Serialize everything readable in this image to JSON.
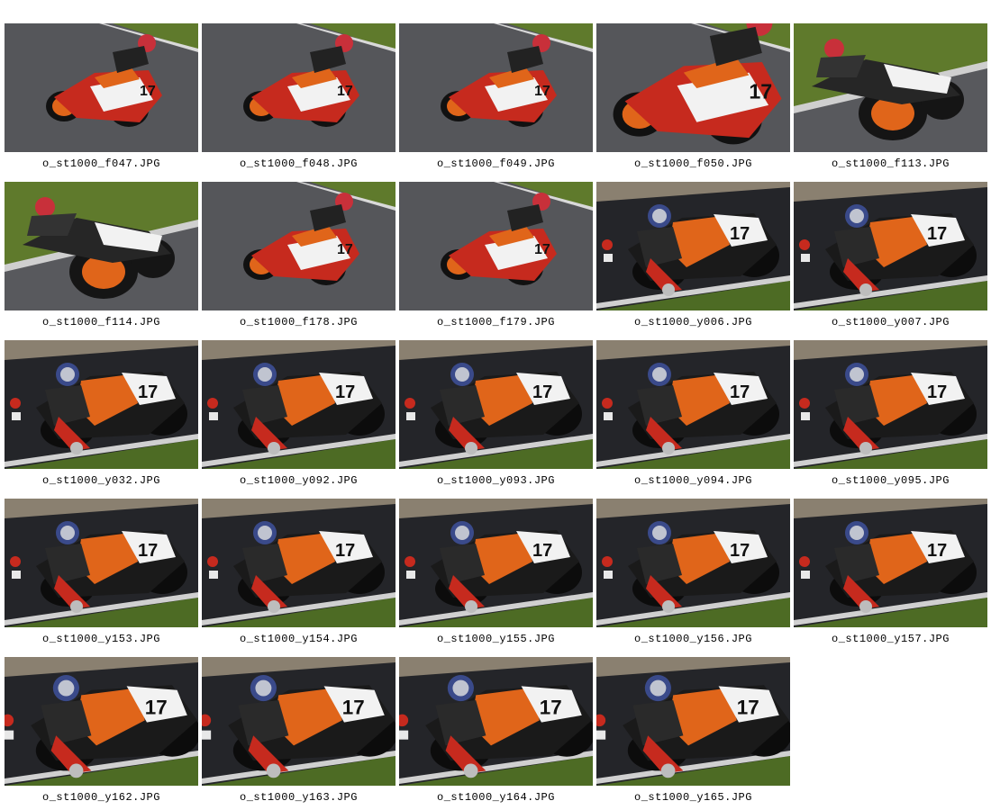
{
  "gallery": {
    "items": [
      {
        "filename": "o_st1000_f047.JPG",
        "scene": "f-far"
      },
      {
        "filename": "o_st1000_f048.JPG",
        "scene": "f-far"
      },
      {
        "filename": "o_st1000_f049.JPG",
        "scene": "f-far"
      },
      {
        "filename": "o_st1000_f050.JPG",
        "scene": "f-close"
      },
      {
        "filename": "o_st1000_f113.JPG",
        "scene": "f-rear"
      },
      {
        "filename": "o_st1000_f114.JPG",
        "scene": "f-rear"
      },
      {
        "filename": "o_st1000_f178.JPG",
        "scene": "f-far"
      },
      {
        "filename": "o_st1000_f179.JPG",
        "scene": "f-far"
      },
      {
        "filename": "o_st1000_y006.JPG",
        "scene": "y"
      },
      {
        "filename": "o_st1000_y007.JPG",
        "scene": "y"
      },
      {
        "filename": "o_st1000_y032.JPG",
        "scene": "y"
      },
      {
        "filename": "o_st1000_y092.JPG",
        "scene": "y"
      },
      {
        "filename": "o_st1000_y093.JPG",
        "scene": "y"
      },
      {
        "filename": "o_st1000_y094.JPG",
        "scene": "y"
      },
      {
        "filename": "o_st1000_y095.JPG",
        "scene": "y"
      },
      {
        "filename": "o_st1000_y153.JPG",
        "scene": "y"
      },
      {
        "filename": "o_st1000_y154.JPG",
        "scene": "y"
      },
      {
        "filename": "o_st1000_y155.JPG",
        "scene": "y"
      },
      {
        "filename": "o_st1000_y156.JPG",
        "scene": "y"
      },
      {
        "filename": "o_st1000_y157.JPG",
        "scene": "y"
      },
      {
        "filename": "o_st1000_y162.JPG",
        "scene": "y-close"
      },
      {
        "filename": "o_st1000_y163.JPG",
        "scene": "y-close"
      },
      {
        "filename": "o_st1000_y164.JPG",
        "scene": "y-close"
      },
      {
        "filename": "o_st1000_y165.JPG",
        "scene": "y-close"
      }
    ]
  },
  "colors": {
    "page_background": "#ffffff",
    "asphalt": "#2c2d31",
    "grass": "#5f7a2c",
    "fairing_orange": "#e0651a",
    "fairing_red": "#c62a1e",
    "number_plate": "#f2f2f2"
  }
}
